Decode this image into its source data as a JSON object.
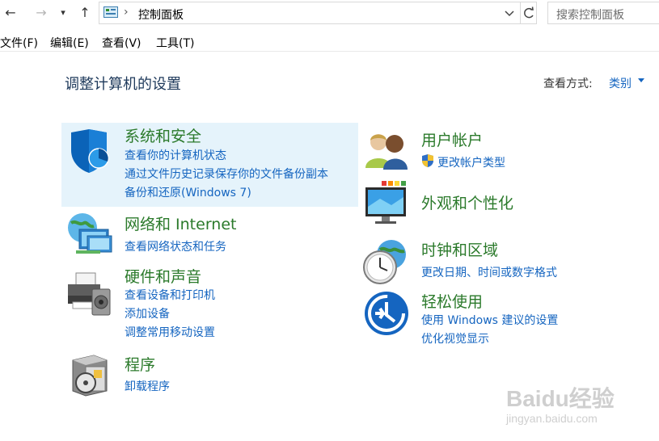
{
  "address_bar": {
    "separator": "›",
    "path": "控制面板",
    "search_placeholder": "搜索控制面板"
  },
  "menu": {
    "items": [
      "文件(F)",
      "编辑(E)",
      "查看(V)",
      "工具(T)"
    ]
  },
  "page": {
    "title": "调整计算机的设置",
    "view_by_label": "查看方式:",
    "view_by_value": "类别"
  },
  "categories": {
    "system_security": {
      "title": "系统和安全",
      "links": [
        "查看你的计算机状态",
        "通过文件历史记录保存你的文件备份副本",
        "备份和还原(Windows 7)"
      ]
    },
    "network": {
      "title": "网络和 Internet",
      "links": [
        "查看网络状态和任务"
      ]
    },
    "hardware": {
      "title": "硬件和声音",
      "links": [
        "查看设备和打印机",
        "添加设备",
        "调整常用移动设置"
      ]
    },
    "programs": {
      "title": "程序",
      "links": [
        "卸载程序"
      ]
    },
    "user_accounts": {
      "title": "用户帐户",
      "links": [
        "更改帐户类型"
      ]
    },
    "appearance": {
      "title": "外观和个性化",
      "links": []
    },
    "clock_region": {
      "title": "时钟和区域",
      "links": [
        "更改日期、时间或数字格式"
      ]
    },
    "ease_of_access": {
      "title": "轻松使用",
      "links": [
        "使用 Windows 建议的设置",
        "优化视觉显示"
      ]
    }
  },
  "watermark": {
    "brand": "Baidu经验",
    "url": "jingyan.baidu.com"
  },
  "colors": {
    "link": "#1565c0",
    "category_title": "#2b7a2b",
    "page_title": "#1e395b",
    "highlight": "#e5f3fb"
  }
}
